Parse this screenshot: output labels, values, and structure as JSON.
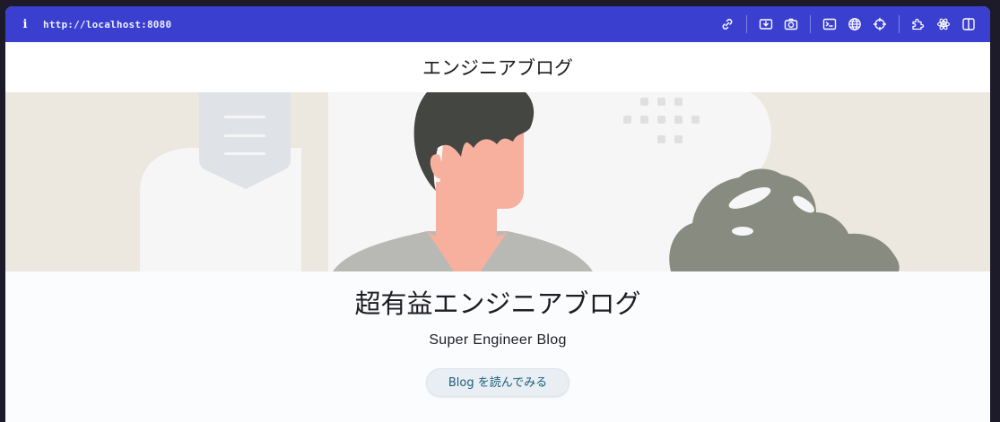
{
  "browser": {
    "url": "http://localhost:8080",
    "toolbar_icons": [
      "link-icon",
      "download-icon",
      "camera-icon",
      "terminal-icon",
      "globe-icon",
      "crosshair-icon",
      "puzzle-icon",
      "react-icon",
      "split-view-icon"
    ]
  },
  "site": {
    "header_title": "エンジニアブログ",
    "heading": "超有益エンジニアブログ",
    "subtitle": "Super Engineer Blog",
    "cta_label": "Blog を読んでみる"
  },
  "colors": {
    "toolbar": "#3a3fd0",
    "page_background": "#fbfcfe",
    "cta_background": "#e8eef3",
    "cta_text": "#1b5f7a"
  }
}
